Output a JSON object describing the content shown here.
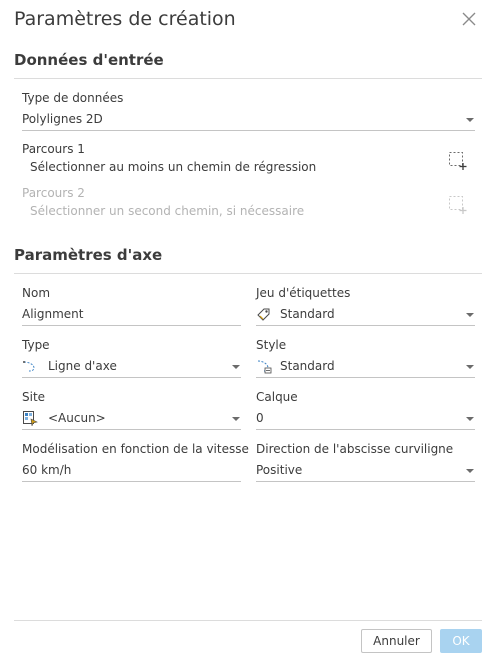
{
  "dialog": {
    "title": "Paramètres de création",
    "close_icon": "close-icon"
  },
  "input_section": {
    "title": "Données d'entrée",
    "data_type": {
      "label": "Type de données",
      "value": "Polylignes 2D"
    },
    "path1": {
      "label": "Parcours 1",
      "hint": "Sélectionner au moins un chemin de régression",
      "icon": "select-path-icon"
    },
    "path2": {
      "label": "Parcours 2",
      "hint": "Sélectionner un second chemin, si nécessaire",
      "icon": "select-path-icon",
      "disabled": true
    }
  },
  "axis_section": {
    "title": "Paramètres d'axe",
    "name": {
      "label": "Nom",
      "value": "Alignment"
    },
    "label_set": {
      "label": "Jeu d'étiquettes",
      "value": "Standard",
      "icon": "label-set-icon"
    },
    "type": {
      "label": "Type",
      "value": "Ligne d'axe",
      "icon": "centerline-icon"
    },
    "style": {
      "label": "Style",
      "value": "Standard",
      "icon": "alignment-style-icon"
    },
    "site": {
      "label": "Site",
      "value": "<Aucun>",
      "icon": "site-icon"
    },
    "layer": {
      "label": "Calque",
      "value": "0"
    },
    "speed_modeling": {
      "label": "Modélisation en fonction de la vitesse",
      "value": "60 km/h"
    },
    "station_direction": {
      "label": "Direction de l'abscisse curviligne",
      "value": "Positive"
    }
  },
  "footer": {
    "cancel_label": "Annuler",
    "ok_label": "OK"
  },
  "colors": {
    "text": "#3c3c3c",
    "disabled_text": "#b3b3b3",
    "ok_button": "#a9d3f0",
    "divider": "#dcdcdc"
  }
}
